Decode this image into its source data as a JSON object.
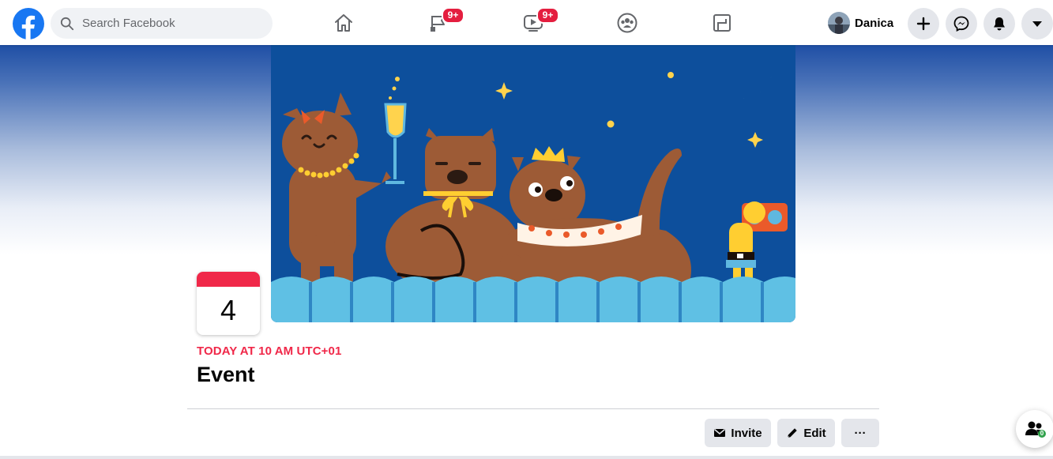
{
  "topbar": {
    "search": {
      "placeholder": "Search Facebook"
    },
    "nav_tabs": [
      {
        "name": "home",
        "icon": "home-icon",
        "badge": ""
      },
      {
        "name": "pages",
        "icon": "flag-icon",
        "badge": "9+"
      },
      {
        "name": "watch",
        "icon": "video-icon",
        "badge": "9+"
      },
      {
        "name": "groups",
        "icon": "groups-icon",
        "badge": ""
      },
      {
        "name": "gaming",
        "icon": "gaming-icon",
        "badge": ""
      }
    ],
    "profile": {
      "name": "Danica"
    },
    "actions": [
      "plus-icon",
      "messenger-icon",
      "bell-icon",
      "caret-down-icon"
    ]
  },
  "event": {
    "date_day": "4",
    "time_text": "TODAY AT 10 AM UTC+01",
    "title": "Event"
  },
  "buttons": {
    "invite_label": "Invite",
    "edit_label": "Edit",
    "more_label": "···"
  },
  "chat": {
    "count": "0"
  },
  "colors": {
    "brand_blue": "#1877f2",
    "accent_red": "#f02849",
    "badge_red": "#e41e3f",
    "cover_bg": "#0d4f9c"
  }
}
